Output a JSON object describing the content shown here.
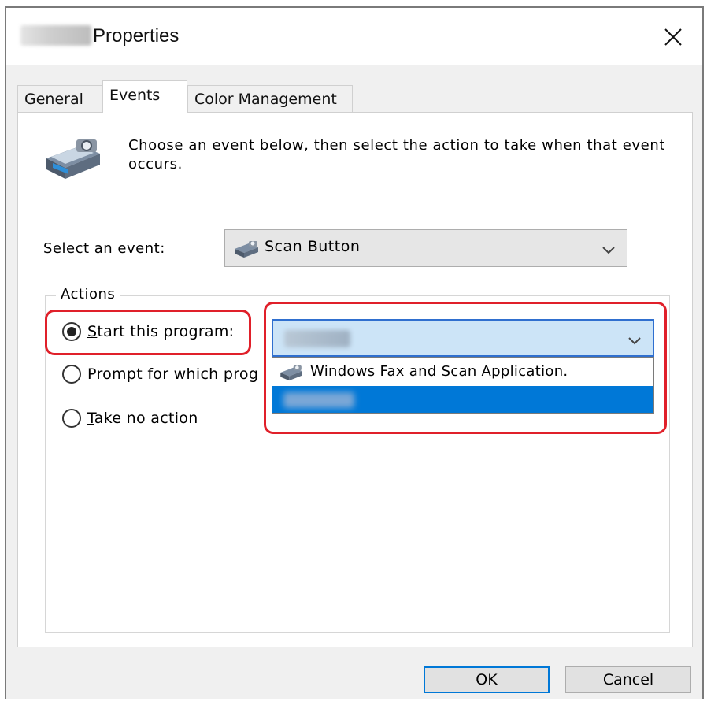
{
  "window": {
    "title": "Properties",
    "close_glyph": "✕"
  },
  "tabs": [
    {
      "label": "General",
      "active": false
    },
    {
      "label": "Events",
      "active": true
    },
    {
      "label": "Color Management",
      "active": false
    }
  ],
  "events_tab": {
    "description": "Choose an event below, then select the action to take when that event occurs.",
    "select_event_label_prefix": "Select an ",
    "select_event_label_mnemonic": "e",
    "select_event_label_suffix": "vent:",
    "selected_event": "Scan Button",
    "actions_legend": "Actions",
    "radios": [
      {
        "mnemonic": "S",
        "rest": "tart this program:",
        "checked": true
      },
      {
        "mnemonic": "P",
        "rest": "rompt for which prog",
        "checked": false
      },
      {
        "mnemonic": "T",
        "rest": "ake no action",
        "checked": false
      }
    ],
    "program_dropdown": {
      "options": [
        {
          "label": "Windows Fax and Scan  Application."
        }
      ]
    }
  },
  "buttons": {
    "ok": "OK",
    "cancel": "Cancel"
  },
  "colors": {
    "highlight_box": "#e0202a",
    "selection": "#0078d7",
    "combo_focus_bg": "#cce4f7"
  },
  "icons": [
    "scanner-icon",
    "scanner-mini-icon",
    "chevron-down-icon",
    "close-icon"
  ]
}
